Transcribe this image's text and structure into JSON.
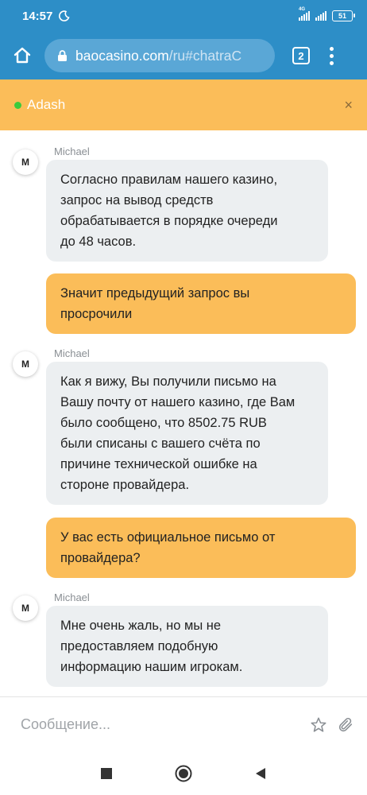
{
  "status_bar": {
    "time": "14:57",
    "signal_label": "4G",
    "battery": "51"
  },
  "browser": {
    "url_host": "baocasino.com",
    "url_path": "/ru#chatraC",
    "tab_count": "2"
  },
  "chat": {
    "agent_name": "Adash",
    "online_color": "#3ccb3c",
    "accent_color": "#fbbd59",
    "close_label": "×",
    "messages": [
      {
        "from": "agent",
        "sender": "Michael",
        "avatar": "M",
        "lines": [
          "Согласно правилам нашего казино,",
          "запрос на вывод средств",
          "обрабатывается в порядке очереди",
          "до 48 часов."
        ]
      },
      {
        "from": "user",
        "lines": [
          "Значит предыдущий запрос вы",
          "просрочили"
        ]
      },
      {
        "from": "agent",
        "sender": "Michael",
        "avatar": "M",
        "lines": [
          "Как я вижу, Вы получили письмо на",
          "Вашу почту от нашего казино, где Вам",
          "было сообщено, что 8502.75 RUB",
          "были списаны с вашего счёта по",
          "причине технической ошибке на",
          "стороне провайдера."
        ]
      },
      {
        "from": "user",
        "lines": [
          "У вас есть официальное письмо от",
          "провайдера?"
        ]
      },
      {
        "from": "agent",
        "sender": "Michael",
        "avatar": "M",
        "lines": [
          "Мне очень жаль, но мы не",
          "предоставляем подобную",
          "информацию нашим игрокам."
        ]
      }
    ]
  },
  "composer": {
    "placeholder": "Сообщение...",
    "value": ""
  },
  "icons": {
    "home": "home-icon",
    "lock": "lock-icon",
    "menu": "more-vert-icon",
    "star": "star-icon",
    "attach": "paperclip-icon"
  }
}
